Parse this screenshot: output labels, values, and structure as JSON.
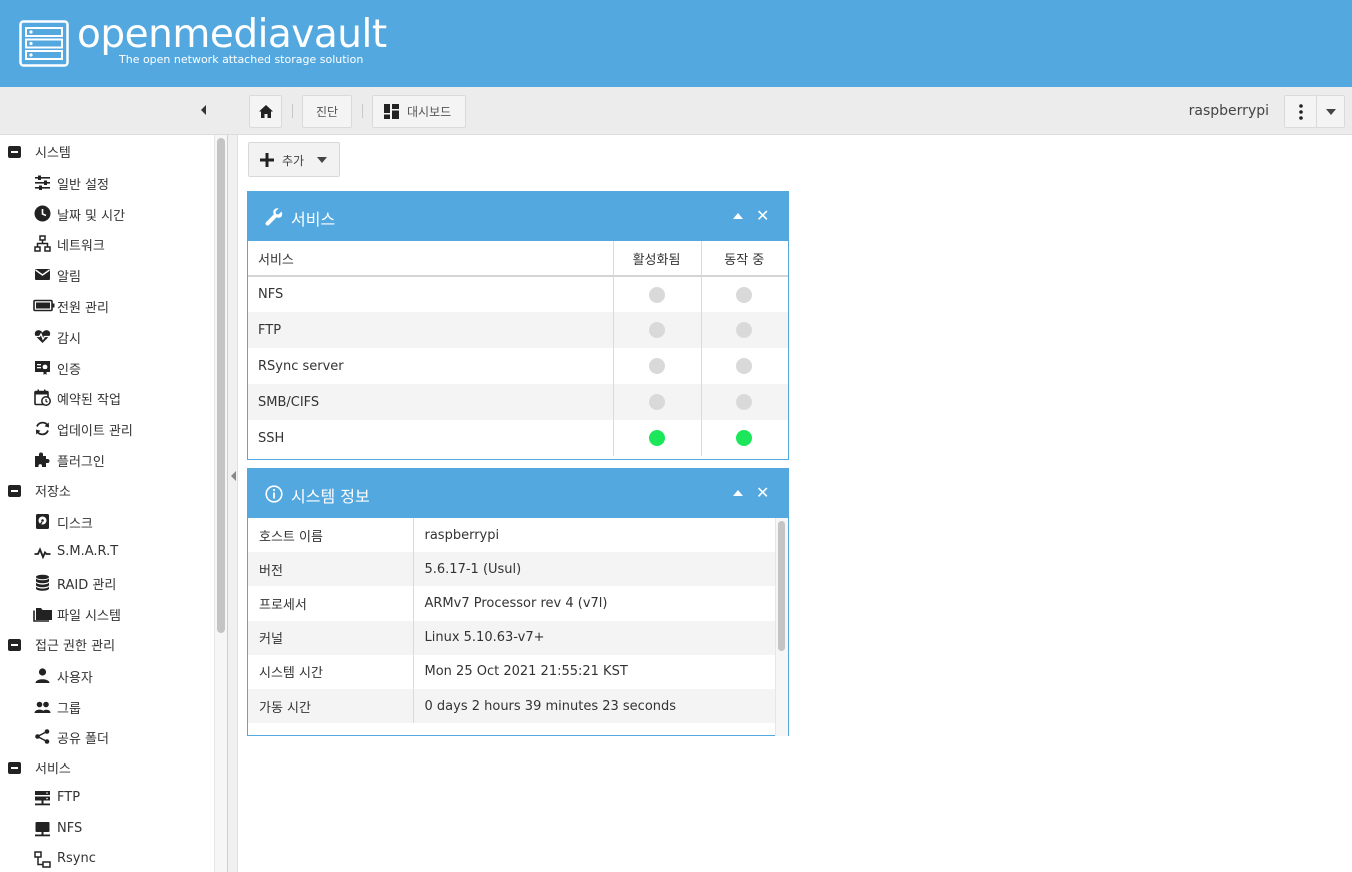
{
  "app": {
    "brand": "openmediavault",
    "tagline": "The open network attached storage solution"
  },
  "toolbar": {
    "home_icon": "home-icon",
    "crumb_diagnostics": "진단",
    "crumb_dashboard": "대시보드",
    "hostname": "raspberrypi"
  },
  "sidebar": {
    "groups": [
      {
        "label": "시스템",
        "items": [
          {
            "label": "일반 설정",
            "icon": "sliders-icon"
          },
          {
            "label": "날짜 및 시간",
            "icon": "clock-icon"
          },
          {
            "label": "네트워크",
            "icon": "network-icon"
          },
          {
            "label": "알림",
            "icon": "mail-icon"
          },
          {
            "label": "전원 관리",
            "icon": "battery-icon"
          },
          {
            "label": "감시",
            "icon": "heartbeat-icon"
          },
          {
            "label": "인증",
            "icon": "certificate-icon"
          },
          {
            "label": "예약된 작업",
            "icon": "calendar-clock-icon"
          },
          {
            "label": "업데이트 관리",
            "icon": "refresh-icon"
          },
          {
            "label": "플러그인",
            "icon": "puzzle-icon"
          }
        ]
      },
      {
        "label": "저장소",
        "items": [
          {
            "label": "디스크",
            "icon": "disk-icon"
          },
          {
            "label": "S.M.A.R.T",
            "icon": "pulse-icon"
          },
          {
            "label": "RAID 관리",
            "icon": "database-icon"
          },
          {
            "label": "파일 시스템",
            "icon": "folder-icon"
          }
        ]
      },
      {
        "label": "접근 권한 관리",
        "items": [
          {
            "label": "사용자",
            "icon": "user-icon"
          },
          {
            "label": "그룹",
            "icon": "group-icon"
          },
          {
            "label": "공유 폴더",
            "icon": "share-icon"
          }
        ]
      },
      {
        "label": "서비스",
        "items": [
          {
            "label": "FTP",
            "icon": "server-icon"
          },
          {
            "label": "NFS",
            "icon": "monitor-icon"
          },
          {
            "label": "Rsync",
            "icon": "sitemap-icon"
          }
        ]
      }
    ]
  },
  "main": {
    "add_label": "추가",
    "services_widget": {
      "title": "서비스",
      "columns": [
        "서비스",
        "활성화됨",
        "동작 중"
      ],
      "rows": [
        {
          "name": "NFS",
          "enabled": false,
          "running": false
        },
        {
          "name": "FTP",
          "enabled": false,
          "running": false
        },
        {
          "name": "RSync server",
          "enabled": false,
          "running": false
        },
        {
          "name": "SMB/CIFS",
          "enabled": false,
          "running": false
        },
        {
          "name": "SSH",
          "enabled": true,
          "running": true
        }
      ]
    },
    "sysinfo_widget": {
      "title": "시스템 정보",
      "rows": [
        {
          "key": "호스트 이름",
          "value": "raspberrypi"
        },
        {
          "key": "버전",
          "value": "5.6.17-1 (Usul)"
        },
        {
          "key": "프로세서",
          "value": "ARMv7 Processor rev 4 (v7l)"
        },
        {
          "key": "커널",
          "value": "Linux 5.10.63-v7+"
        },
        {
          "key": "시스템 시간",
          "value": "Mon 25 Oct 2021 21:55:21 KST"
        },
        {
          "key": "가동 시간",
          "value": "0 days 2 hours 39 minutes 23 seconds"
        }
      ]
    }
  },
  "colors": {
    "accent": "#53a8e0",
    "status_on": "#1ce65a",
    "status_off": "#d9d9d9"
  }
}
